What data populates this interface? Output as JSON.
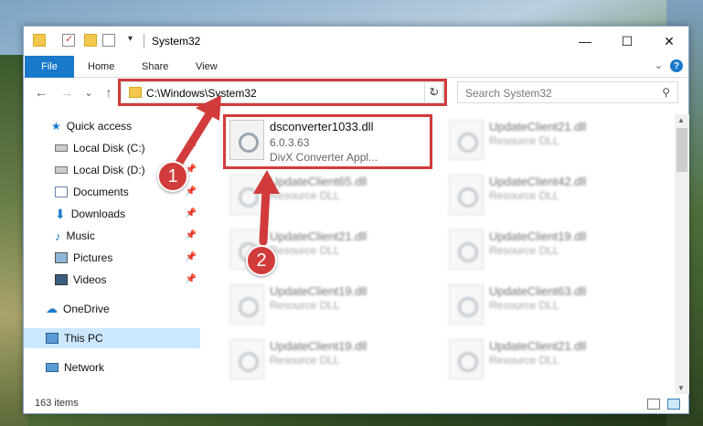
{
  "window": {
    "title": "System32"
  },
  "title_controls": {
    "minimize": "—",
    "maximize": "☐",
    "close": "✕"
  },
  "ribbon": {
    "file": "File",
    "tabs": [
      "Home",
      "Share",
      "View"
    ],
    "expand_chevron": "⌄",
    "help": "?"
  },
  "navigation": {
    "back": "←",
    "forward": "→",
    "recent": "⌄",
    "up": "↑",
    "address": "C:\\Windows\\System32",
    "address_chevron": "⌄",
    "refresh": "↻",
    "search_placeholder": "Search System32",
    "search_icon": "⚲"
  },
  "sidebar": {
    "items": [
      {
        "label": "Quick access",
        "icon": "star-icon",
        "pinned": false
      },
      {
        "label": "Local Disk (C:)",
        "icon": "drive-icon",
        "pinned": true
      },
      {
        "label": "Local Disk (D:)",
        "icon": "drive-icon",
        "pinned": true
      },
      {
        "label": "Documents",
        "icon": "documents-icon",
        "pinned": true
      },
      {
        "label": "Downloads",
        "icon": "download-icon",
        "pinned": true
      },
      {
        "label": "Music",
        "icon": "music-icon",
        "pinned": true
      },
      {
        "label": "Pictures",
        "icon": "pictures-icon",
        "pinned": true
      },
      {
        "label": "Videos",
        "icon": "videos-icon",
        "pinned": true
      },
      {
        "label": "OneDrive",
        "icon": "cloud-icon",
        "pinned": false
      },
      {
        "label": "This PC",
        "icon": "computer-icon",
        "pinned": false,
        "selected": true
      },
      {
        "label": "Network",
        "icon": "network-icon",
        "pinned": false
      }
    ],
    "pin_glyph": "📌"
  },
  "files": {
    "highlighted": {
      "name": "dsconverter1033.dll",
      "version": "6.0.3.63",
      "description": "DivX Converter Appl..."
    },
    "left_column": [
      {
        "name": "UpdateClient65.dll",
        "type": "Resource DLL"
      },
      {
        "name": "UpdateClient21.dll",
        "type": "Resource DLL"
      },
      {
        "name": "UpdateClient19.dll",
        "type": "Resource DLL"
      },
      {
        "name": "UpdateClient19.dll",
        "type": "Resource DLL"
      }
    ],
    "right_column": [
      {
        "name": "UpdateClient21.dll",
        "type": "Resource DLL"
      },
      {
        "name": "UpdateClient42.dll",
        "type": "Resource DLL"
      },
      {
        "name": "UpdateClient19.dll",
        "type": "Resource DLL"
      },
      {
        "name": "UpdateClient63.dll",
        "type": "Resource DLL"
      },
      {
        "name": "UpdateClient21.dll",
        "type": "Resource DLL"
      }
    ]
  },
  "status": {
    "items_count": "163 items"
  },
  "annotations": {
    "step1": "1",
    "step2": "2",
    "accent_color": "#d23b3b"
  }
}
